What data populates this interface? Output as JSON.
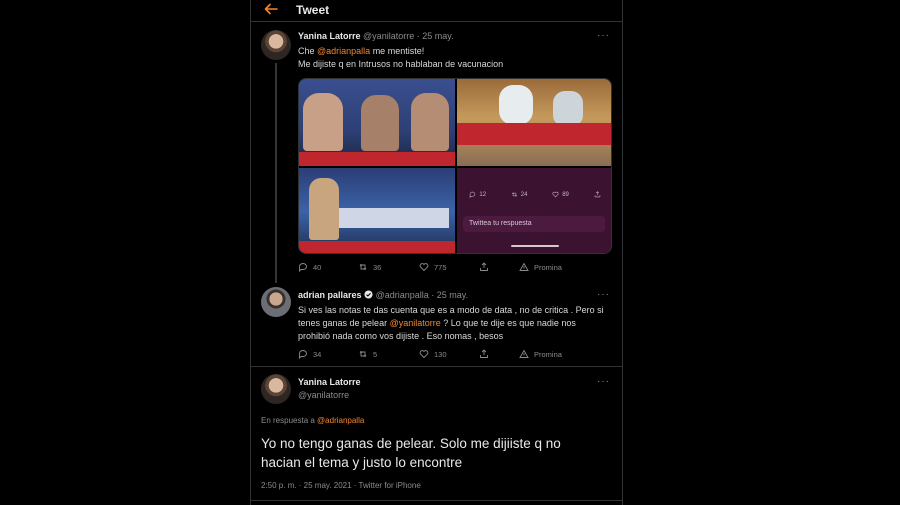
{
  "header": {
    "title": "Tweet",
    "back_icon": "arrow-left-icon",
    "accent": "#f5852b"
  },
  "tweet1": {
    "name": "Yanina Latorre",
    "handle": "@yanilatorre",
    "sep": "·",
    "date": "25 may.",
    "line1_pre": "Che ",
    "line1_mention": "@adrianpalla",
    "line1_post": " me mentiste!",
    "line2": "Me dijiste q en Intrusos no hablaban de vacunacion",
    "media_preview": {
      "replies": "12",
      "retweets": "24",
      "likes": "89",
      "reply_placeholder": "Twittea tu respuesta"
    },
    "replies": "40",
    "retweets": "36",
    "likes": "775",
    "promote": "Promina"
  },
  "tweet2": {
    "name": "adrian pallares",
    "verified_icon": "verified-badge-icon",
    "handle": "@adrianpalla",
    "sep": "·",
    "date": "25 may.",
    "line1": "Si ves las notas te das cuenta que es a modo de data , no de critica . Pero si",
    "line2_pre": "tenes ganas de pelear ",
    "line2_mention": "@yanilatorre",
    "line2_post": " ? Lo que te dije es que nadie nos",
    "line3": "prohibió nada como vos dijiste . Eso nomas , besos",
    "replies": "34",
    "retweets": "5",
    "likes": "130",
    "promote": "Promina"
  },
  "tweet3": {
    "name": "Yanina Latorre",
    "handle": "@yanilatorre",
    "reply_prefix": "En respuesta a ",
    "reply_mention": "@adrianpalla",
    "line1": "Yo no tengo ganas de pelear. Solo me dijiiste q no",
    "line2": "hacian el tema y justo lo encontre",
    "timestamp": "2:50 p. m. · 25 may. 2021 · Twitter for iPhone"
  },
  "more_icon": "···"
}
